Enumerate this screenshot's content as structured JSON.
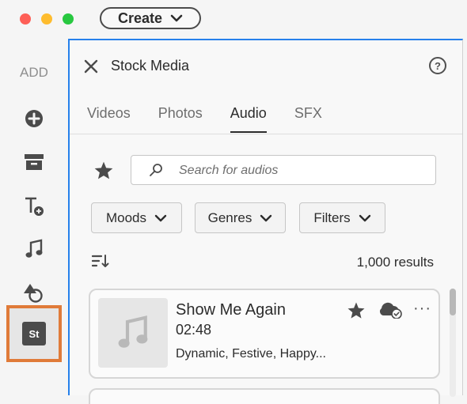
{
  "titlebar": {
    "create_label": "Create"
  },
  "rail": {
    "add_label": "ADD",
    "items": [
      {
        "icon": "plus-circle-icon"
      },
      {
        "icon": "archive-icon"
      },
      {
        "icon": "text-add-icon"
      },
      {
        "icon": "music-note-icon"
      },
      {
        "icon": "shapes-icon"
      },
      {
        "icon": "stock-icon",
        "label": "St"
      }
    ],
    "highlight_color": "#e07b39"
  },
  "panel": {
    "title": "Stock Media",
    "help": "?",
    "tabs": [
      {
        "label": "Videos",
        "active": false
      },
      {
        "label": "Photos",
        "active": false
      },
      {
        "label": "Audio",
        "active": true
      },
      {
        "label": "SFX",
        "active": false
      }
    ],
    "search": {
      "placeholder": "Search for audios",
      "value": ""
    },
    "filters": [
      {
        "label": "Moods"
      },
      {
        "label": "Genres"
      },
      {
        "label": "Filters"
      }
    ],
    "results": "1,000 results",
    "tracks": [
      {
        "title": "Show Me Again",
        "duration": "02:48",
        "tags": "Dynamic, Festive, Happy..."
      }
    ],
    "more": "···"
  },
  "colors": {
    "accent": "#2680eb",
    "highlight": "#e07b39"
  }
}
